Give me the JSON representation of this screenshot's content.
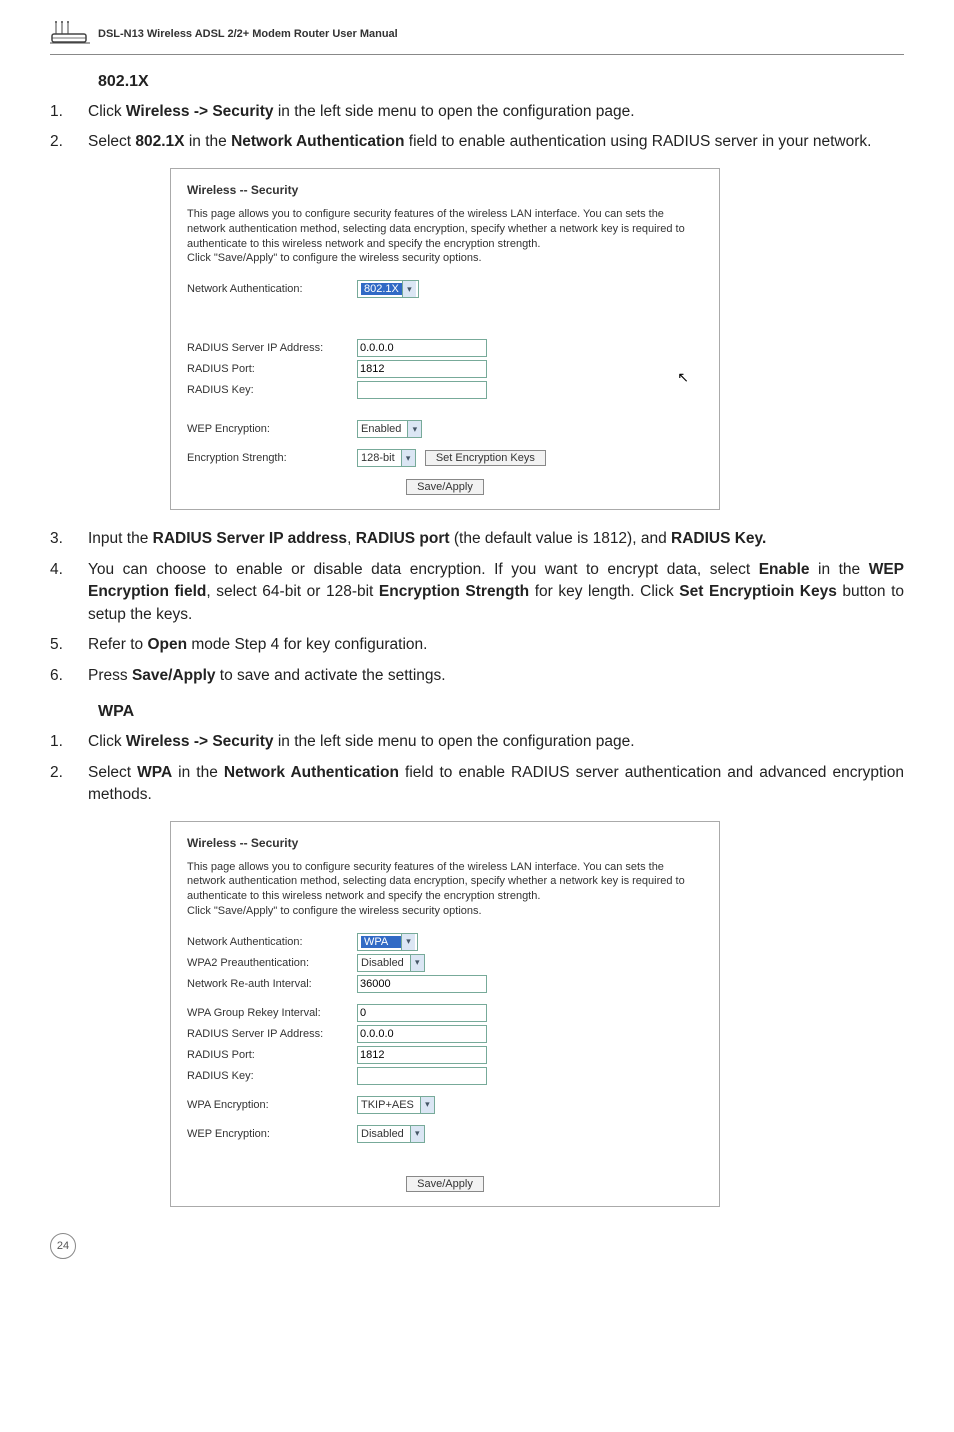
{
  "header": {
    "manual_title": "DSL-N13 Wireless ADSL 2/2+ Modem Router User Manual"
  },
  "sec1": {
    "heading": "802.1X",
    "steps_top": [
      {
        "n": "1.",
        "pre": "Click ",
        "bold1": "Wireless -> Security",
        "post1": " in the left side menu to open the configuration page."
      },
      {
        "n": "2.",
        "pre": "Select ",
        "bold1": "802.1X",
        "mid": " in the ",
        "bold2": "Network Authentication",
        "post1": " field to enable authentication using RADIUS server in your network."
      }
    ],
    "panel": {
      "title": "Wireless -- Security",
      "desc": "This page allows you to configure security features of the wireless LAN interface. You can sets the network authentication method, selecting data encryption, specify whether a network key is required to authenticate to this wireless network and specify the encryption strength.\nClick \"Save/Apply\" to configure the wireless security options.",
      "rows": {
        "net_auth_label": "Network Authentication:",
        "net_auth_value": "802.1X",
        "radius_ip_label": "RADIUS Server IP Address:",
        "radius_ip_value": "0.0.0.0",
        "radius_port_label": "RADIUS Port:",
        "radius_port_value": "1812",
        "radius_key_label": "RADIUS Key:",
        "radius_key_value": "",
        "wep_enc_label": "WEP Encryption:",
        "wep_enc_value": "Enabled",
        "enc_str_label": "Encryption Strength:",
        "enc_str_value": "128-bit",
        "set_keys_btn": "Set Encryption Keys",
        "save_btn": "Save/Apply"
      }
    },
    "steps_bottom": [
      {
        "n": "3.",
        "pre": "Input the ",
        "bold1": "RADIUS Server IP address",
        "mid": ", ",
        "bold2": "RADIUS port",
        "post1": " (the default value is 1812), and ",
        "bold3": "RADIUS Key."
      },
      {
        "n": "4.",
        "pre": "You can choose to enable or disable data encryption. If you want to encrypt data, select ",
        "bold1": "Enable",
        "mid": " in the ",
        "bold2": "WEP Encryption field",
        "post1": ", select 64-bit or 128-bit ",
        "bold3": "Encryption Strength",
        "post2": " for key length. Click ",
        "bold4": "Set Encryptioin Keys",
        "post3": " button to setup the keys."
      },
      {
        "n": "5.",
        "pre": "Refer to ",
        "bold1": "Open",
        "post1": " mode Step 4 for key configuration."
      },
      {
        "n": "6.",
        "pre": "Press ",
        "bold1": "Save/Apply",
        "post1": " to save and activate the settings."
      }
    ]
  },
  "sec2": {
    "heading": "WPA",
    "steps_top": [
      {
        "n": "1.",
        "pre": "Click ",
        "bold1": "Wireless -> Security",
        "post1": " in the left side menu to open the configuration page."
      },
      {
        "n": "2.",
        "pre": "Select ",
        "bold1": "WPA",
        "mid": " in the ",
        "bold2": "Network Authentication",
        "post1": " field to enable RADIUS server authentication and advanced encryption methods."
      }
    ],
    "panel": {
      "title": "Wireless -- Security",
      "desc": "This page allows you to configure security features of the wireless LAN interface. You can sets the network authentication method, selecting data encryption, specify whether a network key is required to authenticate to this wireless network and specify the encryption strength.\nClick \"Save/Apply\" to configure the wireless security options.",
      "rows": {
        "net_auth_label": "Network Authentication:",
        "net_auth_value": "WPA",
        "wpa2_pre_label": "WPA2 Preauthentication:",
        "wpa2_pre_value": "Disabled",
        "reauth_label": "Network Re-auth Interval:",
        "reauth_value": "36000",
        "group_rekey_label": "WPA Group Rekey Interval:",
        "group_rekey_value": "0",
        "radius_ip_label": "RADIUS Server IP Address:",
        "radius_ip_value": "0.0.0.0",
        "radius_port_label": "RADIUS Port:",
        "radius_port_value": "1812",
        "radius_key_label": "RADIUS Key:",
        "radius_key_value": "",
        "wpa_enc_label": "WPA Encryption:",
        "wpa_enc_value": "TKIP+AES",
        "wep_enc_label": "WEP Encryption:",
        "wep_enc_value": "Disabled",
        "save_btn": "Save/Apply"
      }
    }
  },
  "page_number": "24"
}
